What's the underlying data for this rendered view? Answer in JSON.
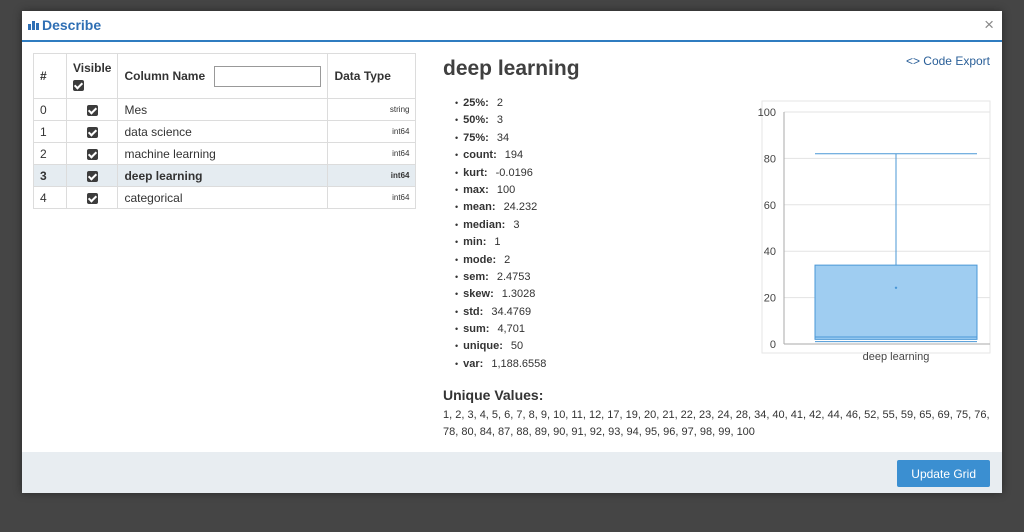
{
  "modal": {
    "title": "Describe",
    "close_glyph": "×"
  },
  "table": {
    "headers": {
      "num": "#",
      "visible": "Visible",
      "column_name": "Column Name",
      "data_type": "Data Type"
    },
    "filter_value": "",
    "rows": [
      {
        "num": "0",
        "name": "Mes",
        "type": "string",
        "visible": true
      },
      {
        "num": "1",
        "name": "data science",
        "type": "int64",
        "visible": true
      },
      {
        "num": "2",
        "name": "machine learning",
        "type": "int64",
        "visible": true
      },
      {
        "num": "3",
        "name": "deep learning",
        "type": "int64",
        "visible": true,
        "selected": true
      },
      {
        "num": "4",
        "name": "categorical",
        "type": "int64",
        "visible": true
      }
    ]
  },
  "details": {
    "title": "deep learning",
    "code_export_label": "Code Export",
    "code_export_icon": "code-brackets-icon",
    "stats": [
      {
        "label": "25%:",
        "value": "2"
      },
      {
        "label": "50%:",
        "value": "3"
      },
      {
        "label": "75%:",
        "value": "34"
      },
      {
        "label": "count:",
        "value": "194"
      },
      {
        "label": "kurt:",
        "value": "-0.0196"
      },
      {
        "label": "max:",
        "value": "100"
      },
      {
        "label": "mean:",
        "value": "24.232"
      },
      {
        "label": "median:",
        "value": "3"
      },
      {
        "label": "min:",
        "value": "1"
      },
      {
        "label": "mode:",
        "value": "2"
      },
      {
        "label": "sem:",
        "value": "2.4753"
      },
      {
        "label": "skew:",
        "value": "1.3028"
      },
      {
        "label": "std:",
        "value": "34.4769"
      },
      {
        "label": "sum:",
        "value": "4,701"
      },
      {
        "label": "unique:",
        "value": "50"
      },
      {
        "label": "var:",
        "value": "1,188.6558"
      }
    ],
    "unique_title": "Unique Values:",
    "unique_values": "1, 2, 3, 4, 5, 6, 7, 8, 9, 10, 11, 12, 17, 19, 20, 21, 22, 23, 24, 28, 34, 40, 41, 42, 44, 46, 52, 55, 59, 65, 69, 75, 76, 78, 80, 84, 87, 88, 89, 90, 91, 92, 93, 94, 95, 96, 97, 98, 99, 100"
  },
  "chart_data": {
    "type": "box",
    "categories": [
      "deep learning"
    ],
    "box": {
      "q1": 2,
      "median": 3,
      "q3": 34,
      "whisker_low": 1,
      "whisker_high": 82,
      "mean": 24.232
    },
    "ylim": [
      0,
      100
    ],
    "yticks": [
      0,
      20,
      40,
      60,
      80,
      100
    ],
    "grid": true,
    "colors": {
      "box_fill": "#9fcdf1",
      "box_stroke": "#4a97d6",
      "grid": "#e3e3e3"
    }
  },
  "footer": {
    "update_label": "Update Grid"
  }
}
